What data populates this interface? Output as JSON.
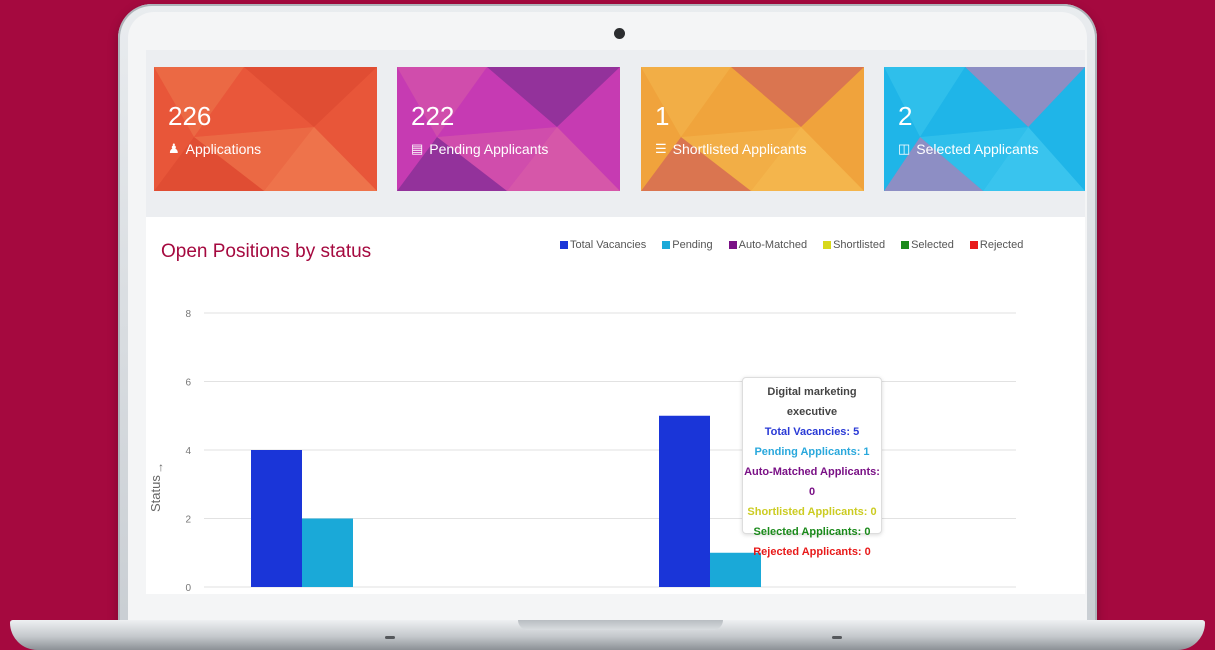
{
  "cards": [
    {
      "value": "226",
      "label": "Applications",
      "icon": "user-icon",
      "colors": [
        "#e9573a",
        "#f28b5a",
        "#d8452e"
      ]
    },
    {
      "value": "222",
      "label": "Pending Applicants",
      "icon": "list-icon",
      "colors": [
        "#c63bb3",
        "#e36fa0",
        "#6a2c86"
      ]
    },
    {
      "value": "1",
      "label": "Shortlisted Applicants",
      "icon": "bars-icon",
      "colors": [
        "#f0a43c",
        "#f7c35a",
        "#c94f61"
      ]
    },
    {
      "value": "2",
      "label": "Selected Applicants",
      "icon": "bookmark-icon",
      "colors": [
        "#1fb5e8",
        "#4ed0f2",
        "#e86ea6"
      ]
    }
  ],
  "chart": {
    "title": "Open Positions by status",
    "y_axis_label": "Status",
    "legend": [
      {
        "name": "Total Vacancies",
        "color": "#1a35d8"
      },
      {
        "name": "Pending",
        "color": "#1aa9d8"
      },
      {
        "name": "Auto-Matched",
        "color": "#7a1186"
      },
      {
        "name": "Shortlisted",
        "color": "#d8d81a"
      },
      {
        "name": "Selected",
        "color": "#1a8a1a"
      },
      {
        "name": "Rejected",
        "color": "#e81a1a"
      }
    ]
  },
  "chart_data": {
    "type": "bar",
    "categories": [
      "",
      ""
    ],
    "series": [
      {
        "name": "Total Vacancies",
        "values": [
          4,
          5
        ]
      },
      {
        "name": "Pending",
        "values": [
          2,
          1
        ]
      }
    ],
    "ylabel": "Status",
    "yticks": [
      0,
      2,
      4,
      6,
      8
    ],
    "ylim": [
      0,
      8
    ],
    "grid": true,
    "legend_position": "top-right"
  },
  "tooltip": {
    "title": "Digital marketing executive",
    "lines": [
      {
        "text": "Total Vacancies: 5",
        "color": "#2a3ad6"
      },
      {
        "text": "Pending Applicants: 1",
        "color": "#29a8dc"
      },
      {
        "text": "Auto-Matched Applicants: 0",
        "color": "#7a1186"
      },
      {
        "text": "Shortlisted Applicants: 0",
        "color": "#cccc22"
      },
      {
        "text": "Selected Applicants: 0",
        "color": "#1a8a1a"
      },
      {
        "text": "Rejected Applicants: 0",
        "color": "#e81a1a"
      }
    ]
  }
}
